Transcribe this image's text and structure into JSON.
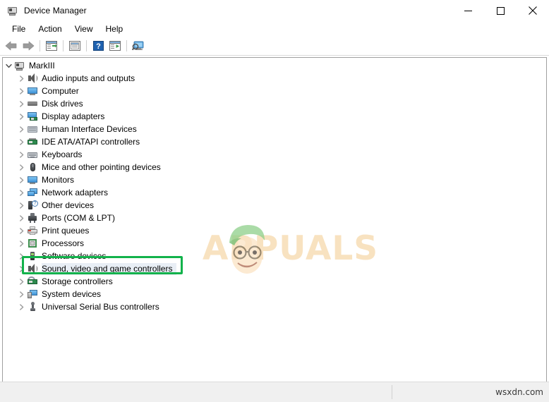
{
  "window": {
    "title": "Device Manager",
    "icon": "device-manager-icon",
    "controls": {
      "minimize": "minimize-button",
      "maximize": "maximize-button",
      "close": "close-button"
    }
  },
  "menubar": {
    "items": [
      {
        "label": "File"
      },
      {
        "label": "Action"
      },
      {
        "label": "View"
      },
      {
        "label": "Help"
      }
    ]
  },
  "toolbar": {
    "buttons": [
      {
        "name": "back-icon"
      },
      {
        "name": "forward-icon"
      },
      {
        "name": "separator"
      },
      {
        "name": "properties-icon"
      },
      {
        "name": "separator"
      },
      {
        "name": "show-hidden-devices-icon"
      },
      {
        "name": "separator"
      },
      {
        "name": "help-icon"
      },
      {
        "name": "update-driver-icon"
      },
      {
        "name": "separator"
      },
      {
        "name": "scan-for-hardware-changes-icon"
      }
    ]
  },
  "tree": {
    "root": {
      "label": "MarkIII",
      "icon": "computer-icon",
      "expanded": true
    },
    "items": [
      {
        "label": "Audio inputs and outputs",
        "icon": "speaker-icon"
      },
      {
        "label": "Computer",
        "icon": "monitor-icon"
      },
      {
        "label": "Disk drives",
        "icon": "disk-drive-icon"
      },
      {
        "label": "Display adapters",
        "icon": "display-adapter-icon"
      },
      {
        "label": "Human Interface Devices",
        "icon": "hid-icon"
      },
      {
        "label": "IDE ATA/ATAPI controllers",
        "icon": "ide-controller-icon"
      },
      {
        "label": "Keyboards",
        "icon": "keyboard-icon"
      },
      {
        "label": "Mice and other pointing devices",
        "icon": "mouse-icon"
      },
      {
        "label": "Monitors",
        "icon": "monitor-icon"
      },
      {
        "label": "Network adapters",
        "icon": "network-adapter-icon"
      },
      {
        "label": "Other devices",
        "icon": "unknown-device-icon"
      },
      {
        "label": "Ports (COM & LPT)",
        "icon": "port-icon"
      },
      {
        "label": "Print queues",
        "icon": "printer-icon"
      },
      {
        "label": "Processors",
        "icon": "processor-icon"
      },
      {
        "label": "Software devices",
        "icon": "software-device-icon"
      },
      {
        "label": "Sound, video and game controllers",
        "icon": "speaker-icon",
        "selected": true,
        "highlighted": true
      },
      {
        "label": "Storage controllers",
        "icon": "storage-controller-icon"
      },
      {
        "label": "System devices",
        "icon": "system-device-icon"
      },
      {
        "label": "Universal Serial Bus controllers",
        "icon": "usb-icon"
      }
    ]
  },
  "annotation": {
    "highlight_color": "#12b24b",
    "target_label": "Sound, video and game controllers"
  },
  "watermark": {
    "text": "APPUALS"
  },
  "statusbar": {
    "left_text": "",
    "right_text": "wsxdn.com"
  }
}
